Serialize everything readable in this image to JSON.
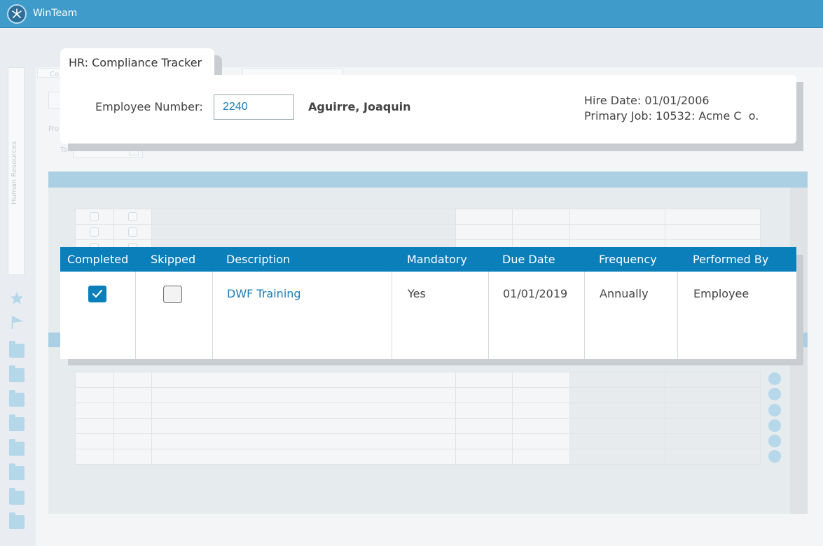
{
  "app": {
    "title": "WinTeam"
  },
  "sidebar": {
    "tab_label": "Human Resources"
  },
  "background": {
    "field_from": "Fro",
    "field_to": "To",
    "tab_fragment": "Co"
  },
  "tracker": {
    "title": "HR: Compliance Tracker",
    "employee_number_label": "Employee Number:",
    "employee_number_value": "2240",
    "employee_name": "Aguirre, Joaquin",
    "hire_date": "Hire Date:  01/01/2006",
    "primary_job": "Primary Job: 10532: Acme C  o."
  },
  "grid": {
    "columns": [
      "Completed",
      "Skipped",
      "Description",
      "Mandatory",
      "Due Date",
      "Frequency",
      "Performed By"
    ],
    "rows": [
      {
        "completed": true,
        "skipped": false,
        "description": "DWF Training",
        "mandatory": "Yes",
        "due_date": "01/01/2019",
        "frequency": "Annually",
        "performed_by": "Employee"
      }
    ]
  },
  "colors": {
    "topbar": "#3f9bc9",
    "accent": "#0a7fba",
    "link": "#1b7cb6"
  }
}
